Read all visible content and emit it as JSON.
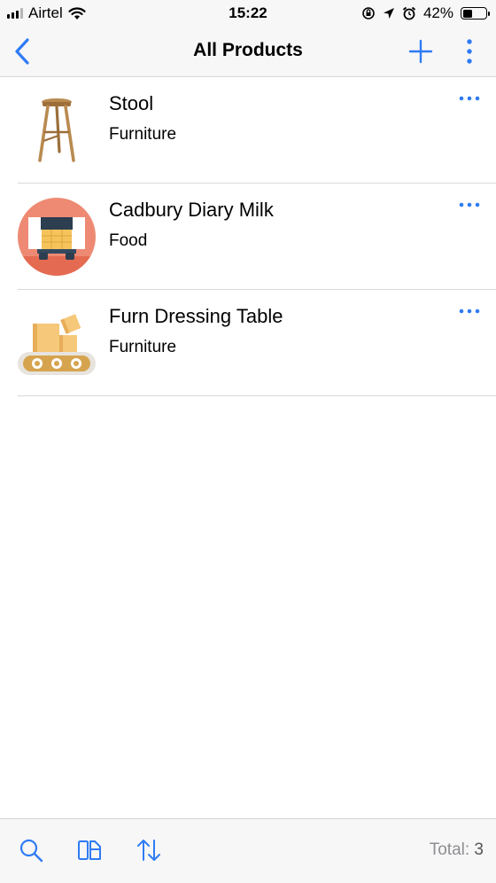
{
  "status_bar": {
    "carrier": "Airtel",
    "time": "15:22",
    "battery": "42%",
    "battery_level": 0.42,
    "icons": [
      "signal-icon",
      "wifi-icon",
      "orientation-lock-icon",
      "location-icon",
      "alarm-icon",
      "battery-icon"
    ]
  },
  "nav": {
    "title": "All Products",
    "icons": [
      "back-chevron-icon",
      "plus-icon",
      "vertical-dots-icon"
    ],
    "accent_color": "#2f7bf5"
  },
  "products": [
    {
      "name": "Stool",
      "category": "Furniture",
      "image": "stool-image"
    },
    {
      "name": "Cadbury Diary Milk",
      "category": "Food",
      "image": "food-truck-image"
    },
    {
      "name": "Furn Dressing Table",
      "category": "Furniture",
      "image": "conveyor-boxes-image"
    }
  ],
  "toolbar": {
    "icons": [
      "search-icon",
      "layout-icon",
      "sort-icon"
    ],
    "total_label": "Total:",
    "total_count": "3"
  }
}
